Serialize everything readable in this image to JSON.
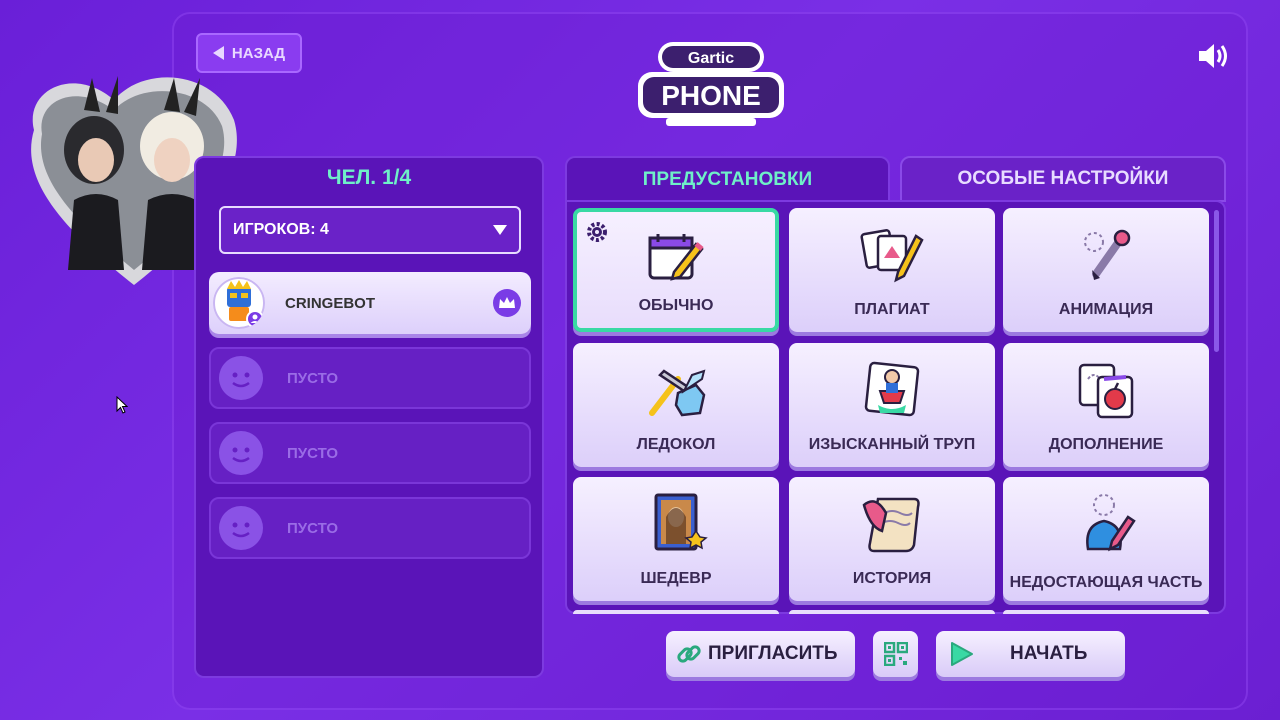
{
  "header": {
    "back_label": "НАЗАД",
    "logo_top": "Gartic",
    "logo_bottom": "PHONE"
  },
  "players": {
    "title": "ЧЕЛ. 1/4",
    "select_value": "ИГРОКОВ: 4",
    "list": [
      {
        "name": "CRINGEBOT",
        "host": true
      },
      {
        "name": "ПУСТО"
      },
      {
        "name": "ПУСТО"
      },
      {
        "name": "ПУСТО"
      }
    ]
  },
  "tabs": {
    "presets": "ПРЕДУСТАНОВКИ",
    "custom": "ОСОБЫЕ НАСТРОЙКИ"
  },
  "modes": [
    {
      "label": "ОБЫЧНО",
      "icon": "calendar-pencil-icon",
      "selected": true
    },
    {
      "label": "ПЛАГИАТ",
      "icon": "copy-cards-icon"
    },
    {
      "label": "АНИМАЦИЯ",
      "icon": "animation-pen-icon"
    },
    {
      "label": "ЛЕДОКОЛ",
      "icon": "ice-pickaxe-icon"
    },
    {
      "label": "ИЗЫСКАННЫЙ ТРУП",
      "icon": "superhero-card-icon"
    },
    {
      "label": "ДОПОЛНЕНИЕ",
      "icon": "apple-card-icon"
    },
    {
      "label": "ШЕДЕВР",
      "icon": "mona-lisa-icon"
    },
    {
      "label": "ИСТОРИЯ",
      "icon": "scroll-quill-icon"
    },
    {
      "label": "НЕДОСТАЮЩАЯ ЧАСТЬ",
      "icon": "missing-piece-icon"
    }
  ],
  "actions": {
    "invite": "ПРИГЛАСИТЬ",
    "start": "НАЧАТЬ"
  },
  "colors": {
    "accent_green": "#6ff0c8",
    "selected_border": "#39d9a4",
    "background": "#6a1fd8"
  }
}
